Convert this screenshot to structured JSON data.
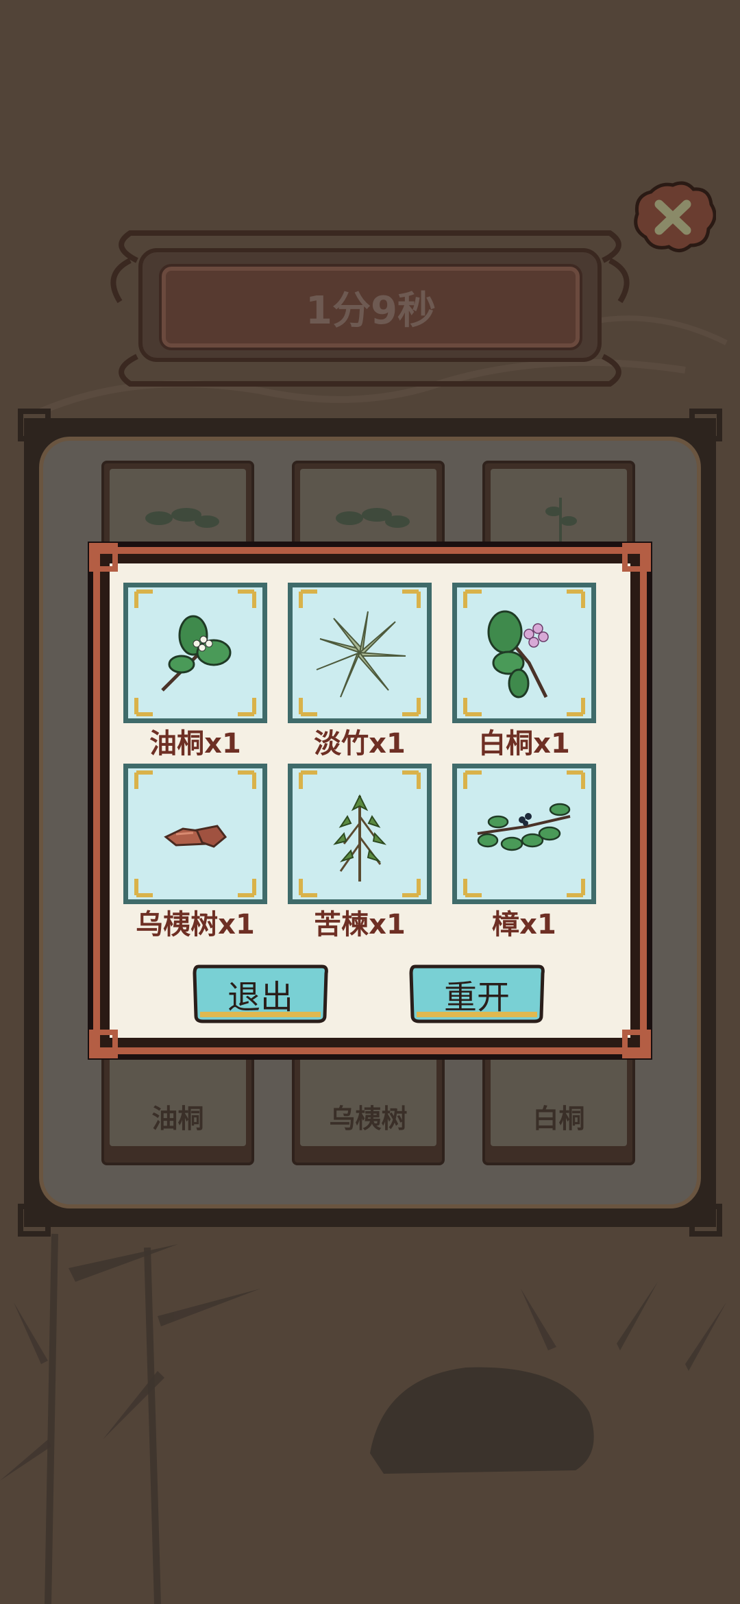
{
  "timer": {
    "text": "1分9秒"
  },
  "close_button": {
    "icon": "close-icon"
  },
  "board": {
    "cards": [
      {
        "label": "油桐",
        "icon": "leaf-branch-icon"
      },
      {
        "label": "乌桋树",
        "icon": "bark-icon"
      },
      {
        "label": "白桐",
        "icon": "leaf-branch-icon"
      }
    ]
  },
  "dialog": {
    "items": [
      {
        "label": "油桐x1",
        "icon": "tung-plant-icon"
      },
      {
        "label": "淡竹x1",
        "icon": "bamboo-leaves-icon"
      },
      {
        "label": "白桐x1",
        "icon": "flower-plant-icon"
      },
      {
        "label": "乌桋树x1",
        "icon": "bark-pieces-icon"
      },
      {
        "label": "苦楝x1",
        "icon": "herb-plant-icon"
      },
      {
        "label": "樟x1",
        "icon": "camphor-branch-icon"
      }
    ],
    "buttons": {
      "exit_label": "退出",
      "restart_label": "重开"
    }
  },
  "colors": {
    "background": "#524438",
    "dialog_border": "#b45e44",
    "paper": "#f5f0e4",
    "item_bg": "#ccecef",
    "item_border": "#3f6b6a",
    "item_label": "#6e2f24",
    "button_fill": "#79d0d4",
    "button_trim": "#e0b84f"
  }
}
